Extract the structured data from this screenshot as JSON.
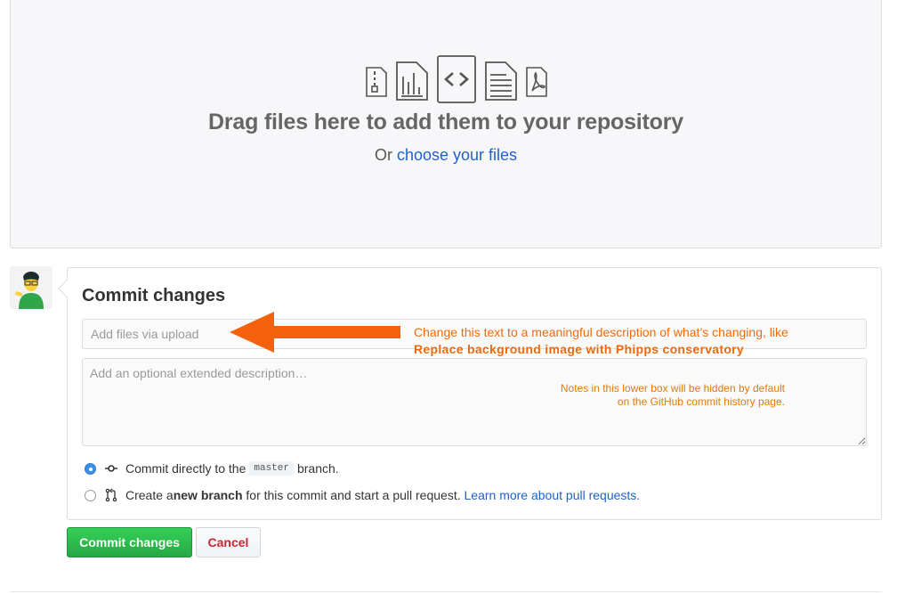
{
  "dropzone": {
    "heading": "Drag files here to add them to your repository",
    "sub_prefix": "Or ",
    "sub_link": "choose your files",
    "file_icons": [
      "zip-file-icon",
      "chart-file-icon",
      "code-file-icon",
      "text-file-icon",
      "pdf-file-icon"
    ]
  },
  "commit": {
    "title": "Commit changes",
    "summary_placeholder": "Add files via upload",
    "description_placeholder": "Add an optional extended description…",
    "option_direct": {
      "prefix": "Commit directly to the ",
      "branch": "master",
      "suffix": " branch.",
      "selected": true
    },
    "option_new_branch": {
      "prefix": "Create a ",
      "bold": "new branch",
      "suffix": " for this commit and start a pull request. ",
      "link": "Learn more about pull requests.",
      "selected": false
    }
  },
  "annotations": {
    "summary_note_line1": "Change this text to a meaningful description of what’s changing, like",
    "summary_note_line2": "Replace background image with Phipps conservatory",
    "description_note_line1": "Notes in this lower box will be hidden by default",
    "description_note_line2": "on the GitHub commit history page."
  },
  "buttons": {
    "commit": "Commit changes",
    "cancel": "Cancel"
  },
  "colors": {
    "annotation": "#f06a0d",
    "commit_button": "#28a745",
    "cancel_text": "#cb2431",
    "link": "#1e62c9"
  }
}
